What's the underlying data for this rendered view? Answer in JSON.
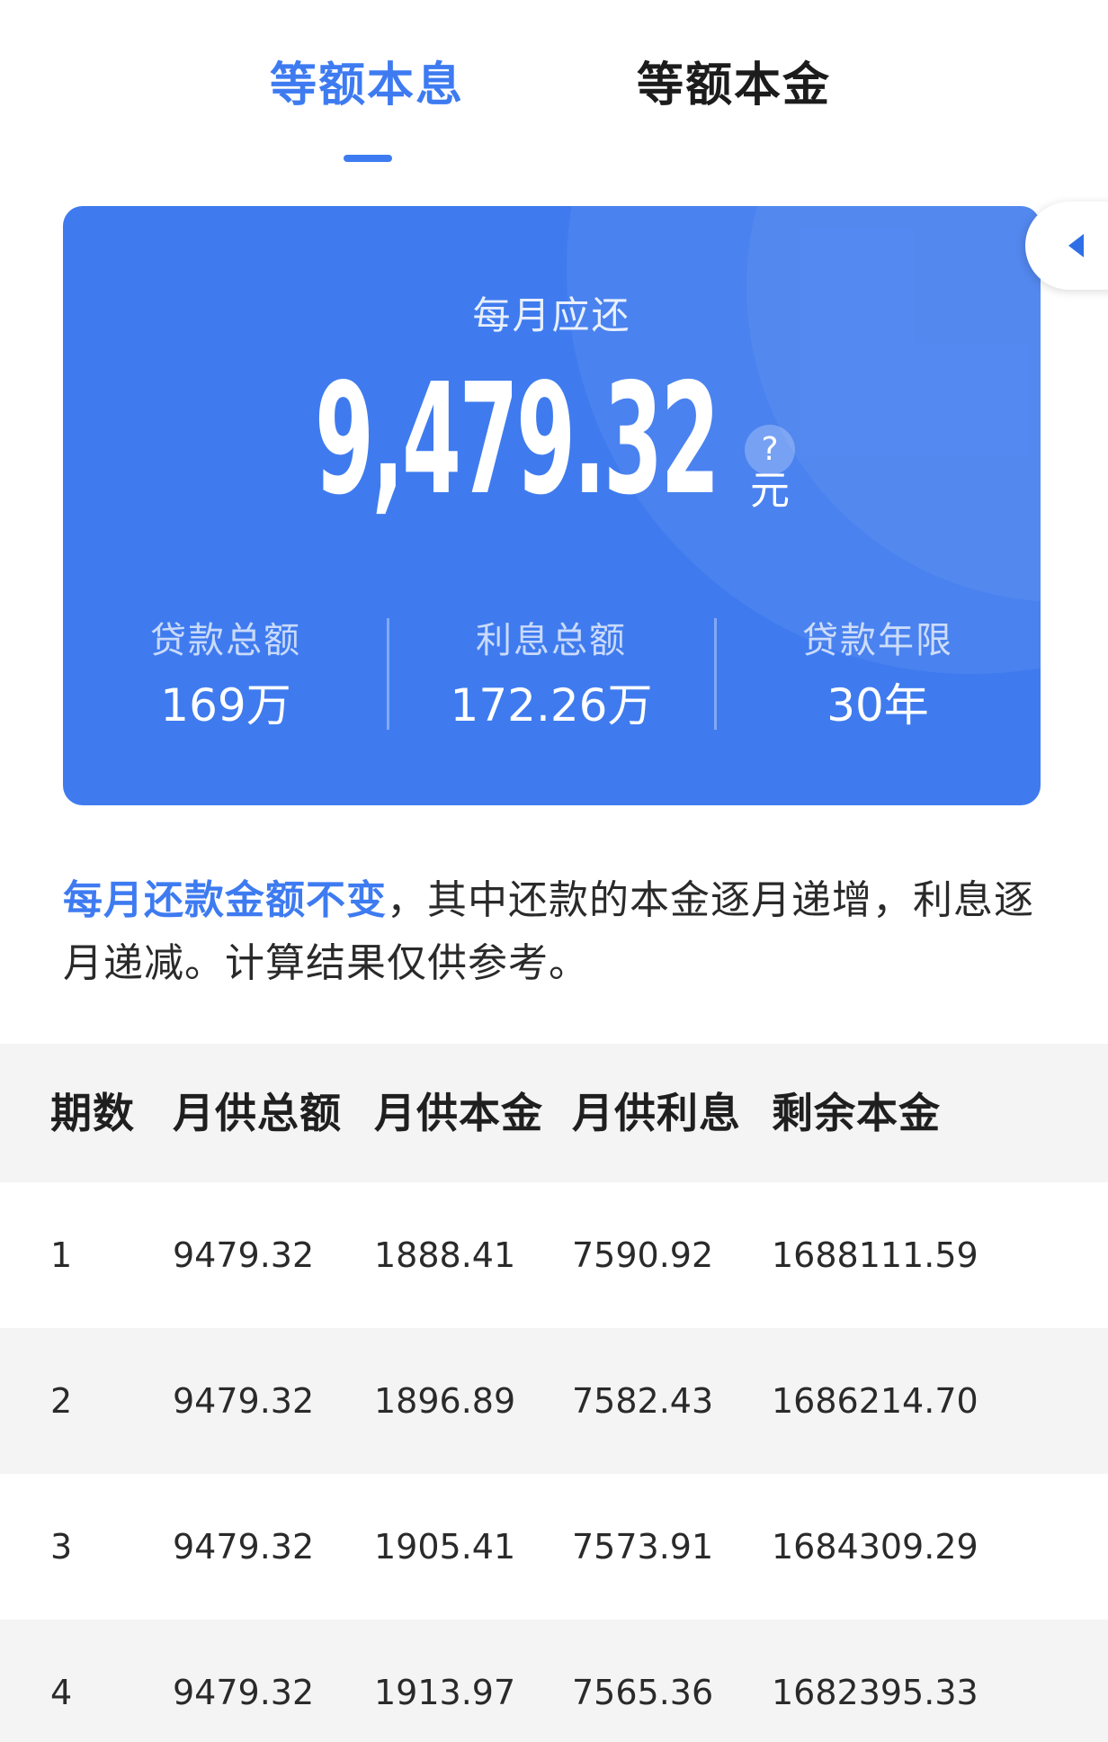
{
  "tabs": [
    {
      "label": "等额本息",
      "active": true
    },
    {
      "label": "等额本金",
      "active": false
    }
  ],
  "colors": {
    "accent": "#3e7bf1",
    "card": "#3f7bef",
    "row_alt": "#f4f4f4"
  },
  "summary": {
    "label": "每月应还",
    "amount": "9,479.32",
    "unit": "元",
    "help": "?",
    "stats": [
      {
        "label": "贷款总额",
        "value": "169万"
      },
      {
        "label": "利息总额",
        "value": "172.26万"
      },
      {
        "label": "贷款年限",
        "value": "30年"
      }
    ]
  },
  "description": {
    "highlight": "每月还款金额不变",
    "text": "，其中还款的本金逐月递增，利息逐月递减。计算结果仅供参考。"
  },
  "table": {
    "headers": [
      "期数",
      "月供总额",
      "月供本金",
      "月供利息",
      "剩余本金"
    ],
    "rows": [
      [
        "1",
        "9479.32",
        "1888.41",
        "7590.92",
        "1688111.59"
      ],
      [
        "2",
        "9479.32",
        "1896.89",
        "7582.43",
        "1686214.70"
      ],
      [
        "3",
        "9479.32",
        "1905.41",
        "7573.91",
        "1684309.29"
      ],
      [
        "4",
        "9479.32",
        "1913.97",
        "7565.36",
        "1682395.33"
      ]
    ]
  },
  "icons": {
    "side_handle": "caret-left-icon",
    "help": "question-icon"
  }
}
